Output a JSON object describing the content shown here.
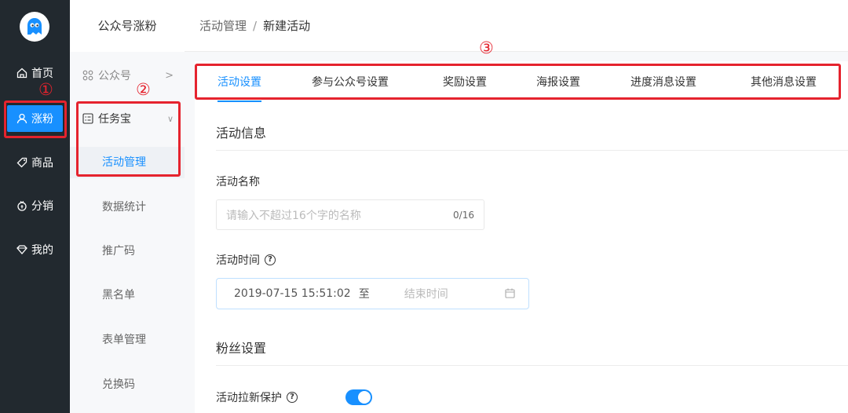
{
  "nav": {
    "items": [
      {
        "label": "首页",
        "icon": "home-icon"
      },
      {
        "label": "涨粉",
        "icon": "user-icon"
      },
      {
        "label": "商品",
        "icon": "tag-icon"
      },
      {
        "label": "分销",
        "icon": "coin-icon"
      },
      {
        "label": "我的",
        "icon": "diamond-icon"
      }
    ]
  },
  "subnav": {
    "title": "公众号涨粉",
    "group1": {
      "label": "公众号",
      "arrow": ">"
    },
    "group2": {
      "label": "任务宝",
      "arrow": "∨"
    },
    "items": [
      "活动管理",
      "数据统计",
      "推广码",
      "黑名单",
      "表单管理",
      "兑换码"
    ]
  },
  "breadcrumb": {
    "parent": "活动管理",
    "separator": "/",
    "current": "新建活动"
  },
  "tabs": [
    "活动设置",
    "参与公众号设置",
    "奖励设置",
    "海报设置",
    "进度消息设置",
    "其他消息设置"
  ],
  "form": {
    "section_info": "活动信息",
    "name_label": "活动名称",
    "name_placeholder": "请输入不超过16个字的名称",
    "name_count": "0/16",
    "time_label": "活动时间",
    "time_start": "2019-07-15 15:51:02",
    "time_sep": "至",
    "time_end_placeholder": "结束时间",
    "section_fans": "粉丝设置",
    "protect_label": "活动拉新保护",
    "protect_on": true
  },
  "annotations": [
    "①",
    "②",
    "③"
  ],
  "colors": {
    "accent": "#1890ff",
    "annotation": "#e5232e",
    "nav_bg": "#22292f"
  }
}
